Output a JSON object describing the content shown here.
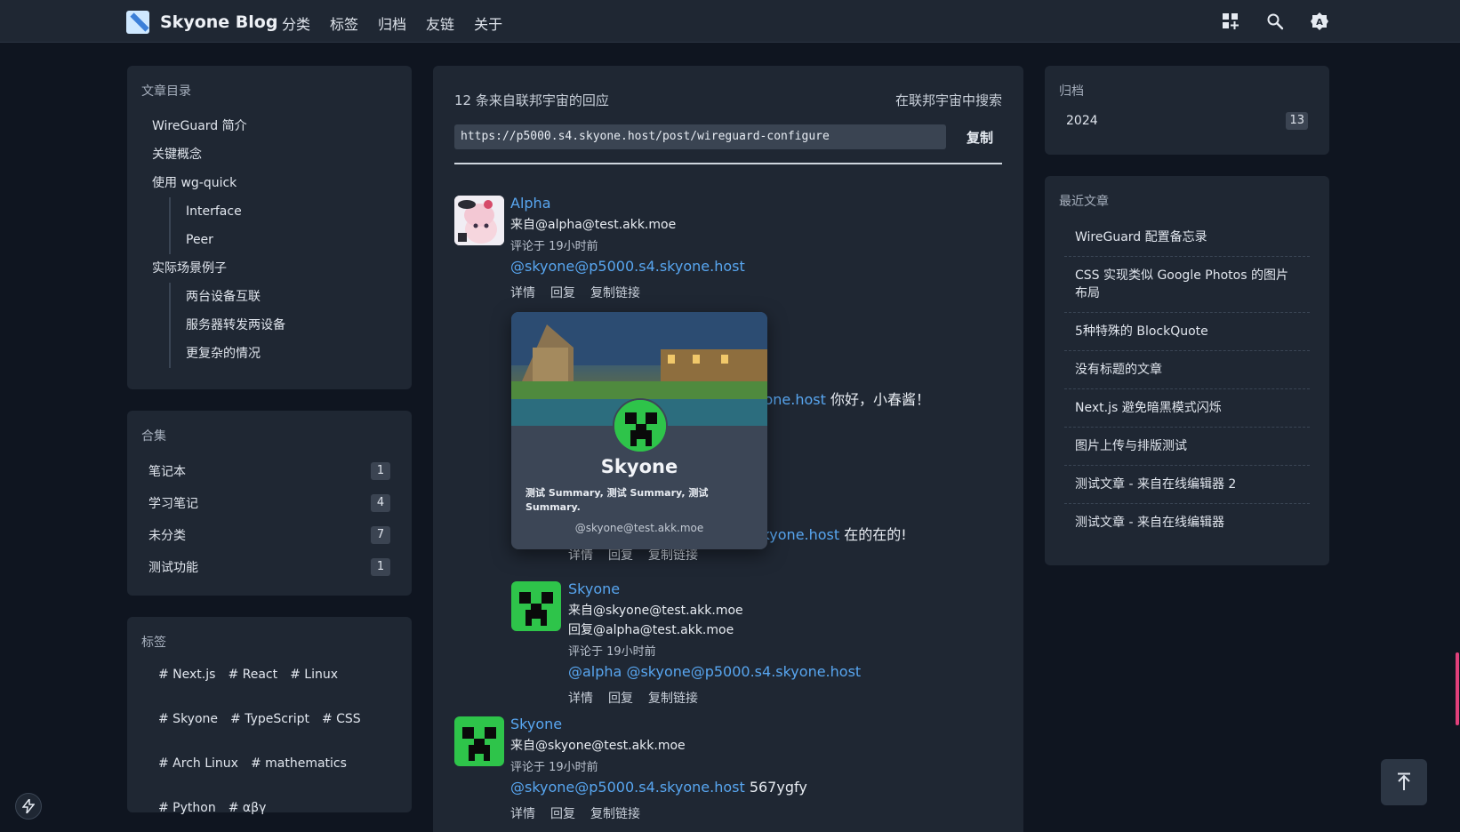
{
  "header": {
    "brand": "Skyone Blog",
    "nav": [
      "分类",
      "标签",
      "归档",
      "友链",
      "关于"
    ],
    "icons": [
      "grid-plus-icon",
      "search-icon",
      "theme-icon"
    ]
  },
  "toc": {
    "title": "文章目录",
    "items": [
      "WireGuard 简介",
      "关键概念",
      "使用 wg-quick"
    ],
    "sub1": [
      "Interface",
      "Peer"
    ],
    "item4": "实际场景例子",
    "sub2": [
      "两台设备互联",
      "服务器转发两设备",
      "更复杂的情况"
    ]
  },
  "collections": {
    "title": "合集",
    "items": [
      {
        "name": "笔记本",
        "count": "1"
      },
      {
        "name": "学习笔记",
        "count": "4"
      },
      {
        "name": "未分类",
        "count": "7"
      },
      {
        "name": "测试功能",
        "count": "1"
      }
    ]
  },
  "tags": {
    "title": "标签",
    "items": [
      "# Next.js",
      "# React",
      "# Linux",
      "# Skyone",
      "# TypeScript",
      "# CSS",
      "# Arch Linux",
      "# mathematics",
      "# Python",
      "# αβγ"
    ]
  },
  "federation": {
    "count_text": "12 条来自联邦宇宙的回应",
    "search_text": "在联邦宇宙中搜索",
    "url": "https://p5000.s4.skyone.host/post/wireguard-configure",
    "copy_label": "复制"
  },
  "comments": [
    {
      "author": "Alpha",
      "from": "来自@alpha@test.akk.moe",
      "time": "评论于 19小时前",
      "mention": "@skyone@p5000.s4.skyone.host",
      "text": "",
      "actions": [
        "详情",
        "回复",
        "复制链接"
      ]
    },
    {
      "mention_partial": "skyone.host",
      "text": " 你好，小春酱！"
    },
    {
      "mention_partial": "4.skyone.host",
      "text": " 在的在的!",
      "actions": [
        "详情",
        "回复",
        "复制链接"
      ]
    },
    {
      "author": "Skyone",
      "from": "来自@skyone@test.akk.moe",
      "reply_to": "回复@alpha@test.akk.moe",
      "time": "评论于 19小时前",
      "mention": "@alpha @skyone@p5000.s4.skyone.host",
      "text": "",
      "actions": [
        "详情",
        "回复",
        "复制链接"
      ]
    },
    {
      "author": "Skyone",
      "from": "来自@skyone@test.akk.moe",
      "time": "评论于 19小时前",
      "mention": "@skyone@p5000.s4.skyone.host",
      "text": " 567ygfy",
      "actions": [
        "详情",
        "回复",
        "复制链接"
      ]
    }
  ],
  "hover_card": {
    "name": "Skyone",
    "summary": "测试 Summary, 测试 Summary, 测试 Summary.",
    "handle": "@skyone@test.akk.moe"
  },
  "archive": {
    "title": "归档",
    "year": "2024",
    "count": "13"
  },
  "recent": {
    "title": "最近文章",
    "items": [
      "WireGuard 配置备忘录",
      "CSS 实现类似 Google Photos 的图片布局",
      "5种特殊的 BlockQuote",
      "没有标题的文章",
      "Next.js 避免暗黑模式闪烁",
      "图片上传与排版测试",
      "测试文章 - 来自在线编辑器 2",
      "测试文章 - 来自在线编辑器"
    ]
  },
  "colors": {
    "accent_link": "#58a6f0",
    "background": "#0f1520",
    "card": "#1f2733",
    "creeper": "#2ec44a"
  }
}
